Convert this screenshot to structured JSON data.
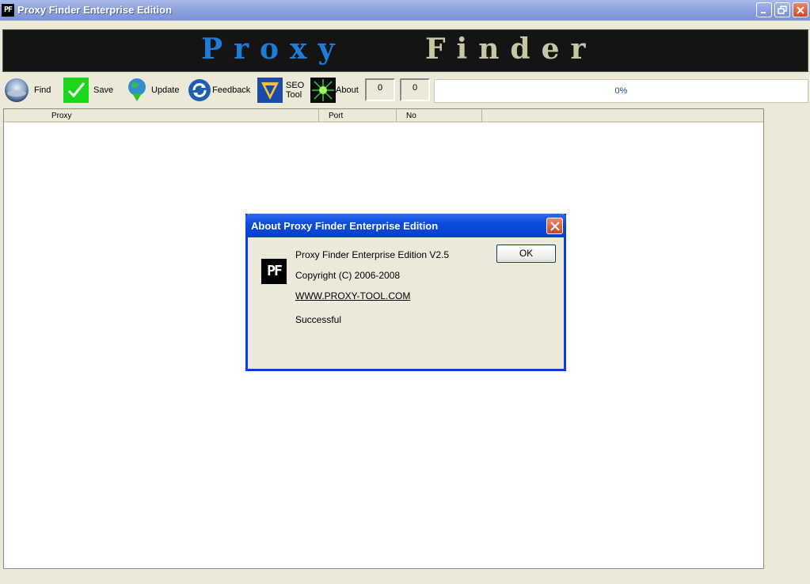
{
  "window": {
    "title": "Proxy Finder Enterprise Edition",
    "icon_text": "PF",
    "controls": [
      "minimize-icon",
      "restore-icon",
      "close-icon"
    ]
  },
  "banner": {
    "word1": "Proxy",
    "word2": "Finder"
  },
  "toolbar": {
    "find": "Find",
    "save": "Save",
    "update": "Update",
    "feedback": "Feedback",
    "seo_line1": "SEO",
    "seo_line2": "Tool",
    "about": "About",
    "counter1": "0",
    "counter2": "0",
    "progress_text": "0%",
    "progress_value": 0
  },
  "table": {
    "columns": [
      "Proxy",
      "Port",
      "No"
    ]
  },
  "dialog": {
    "title": "About Proxy Finder Enterprise Edition",
    "icon_text": "PF",
    "product": "Proxy Finder Enterprise Edition V2.5",
    "copyright": "Copyright (C) 2006-2008",
    "link": "WWW.PROXY-TOOL.COM",
    "status": "Successful",
    "ok": "OK"
  },
  "colors": {
    "titlebar": "#8fa3de",
    "dialog_title": "#0a4ce0",
    "face": "#ece9d8",
    "progress_text": "#234a9e"
  }
}
